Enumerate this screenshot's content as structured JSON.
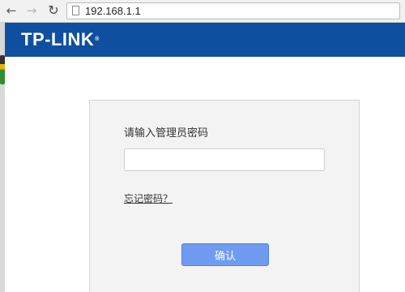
{
  "browser": {
    "url": "192.168.1.1",
    "icons": {
      "back": "back-arrow-icon",
      "forward": "forward-arrow-icon",
      "reload": "reload-icon",
      "page": "page-icon"
    }
  },
  "header": {
    "logo_text": "TP-LINK",
    "logo_mark": "®",
    "background_color": "#0e4fa0"
  },
  "login": {
    "prompt": "请输入管理员密码",
    "password_value": "",
    "forgot_link": "忘记密码？",
    "confirm_label": "确认",
    "button_color": "#6f9cf0"
  }
}
